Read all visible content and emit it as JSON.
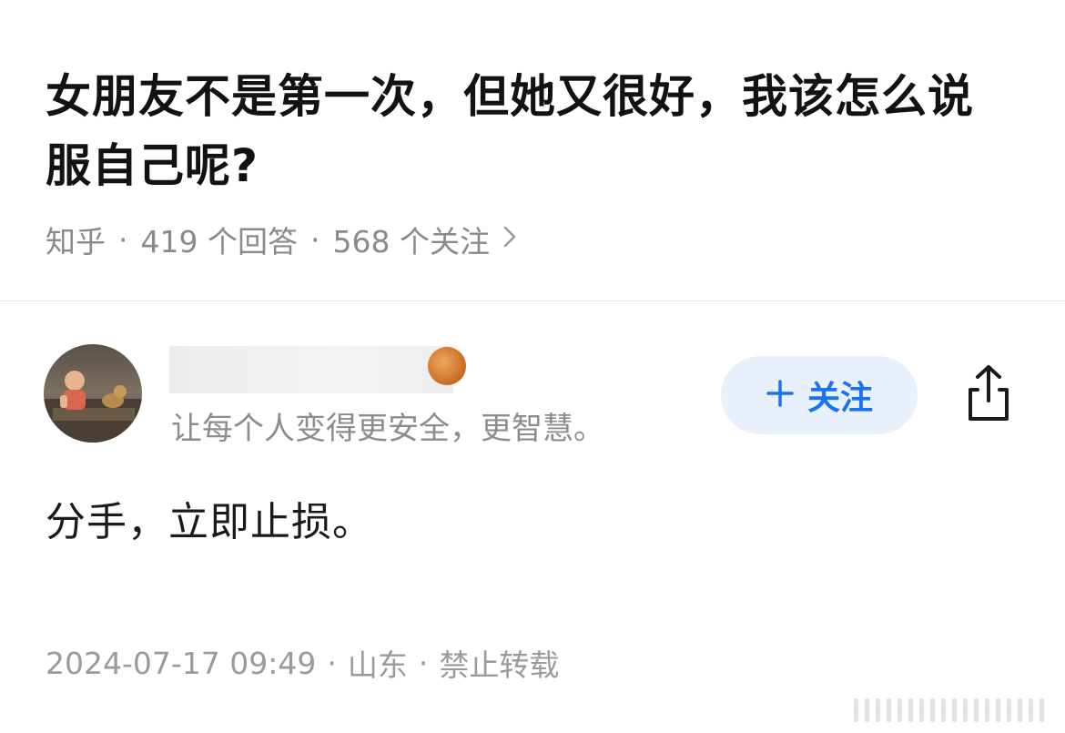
{
  "question": {
    "title": "女朋友不是第一次，但她又很好，我该怎么说服自己呢?",
    "source": "知乎",
    "answers_count": "419 个回答",
    "followers_count": "568 个关注"
  },
  "author": {
    "bio": "让每个人变得更安全，更智慧。",
    "follow_label": "关注"
  },
  "answer": {
    "content": "分手，立即止损。",
    "timestamp": "2024-07-17 09:49",
    "location": "山东",
    "copyright": "禁止转载"
  },
  "colors": {
    "accent": "#1772f6",
    "follow_bg": "#e8f0fb",
    "meta_text": "#8a8a8a"
  },
  "icons": {
    "meta_chevron": "chevron-right-icon",
    "follow_plus": "plus-icon",
    "share": "share-icon"
  }
}
